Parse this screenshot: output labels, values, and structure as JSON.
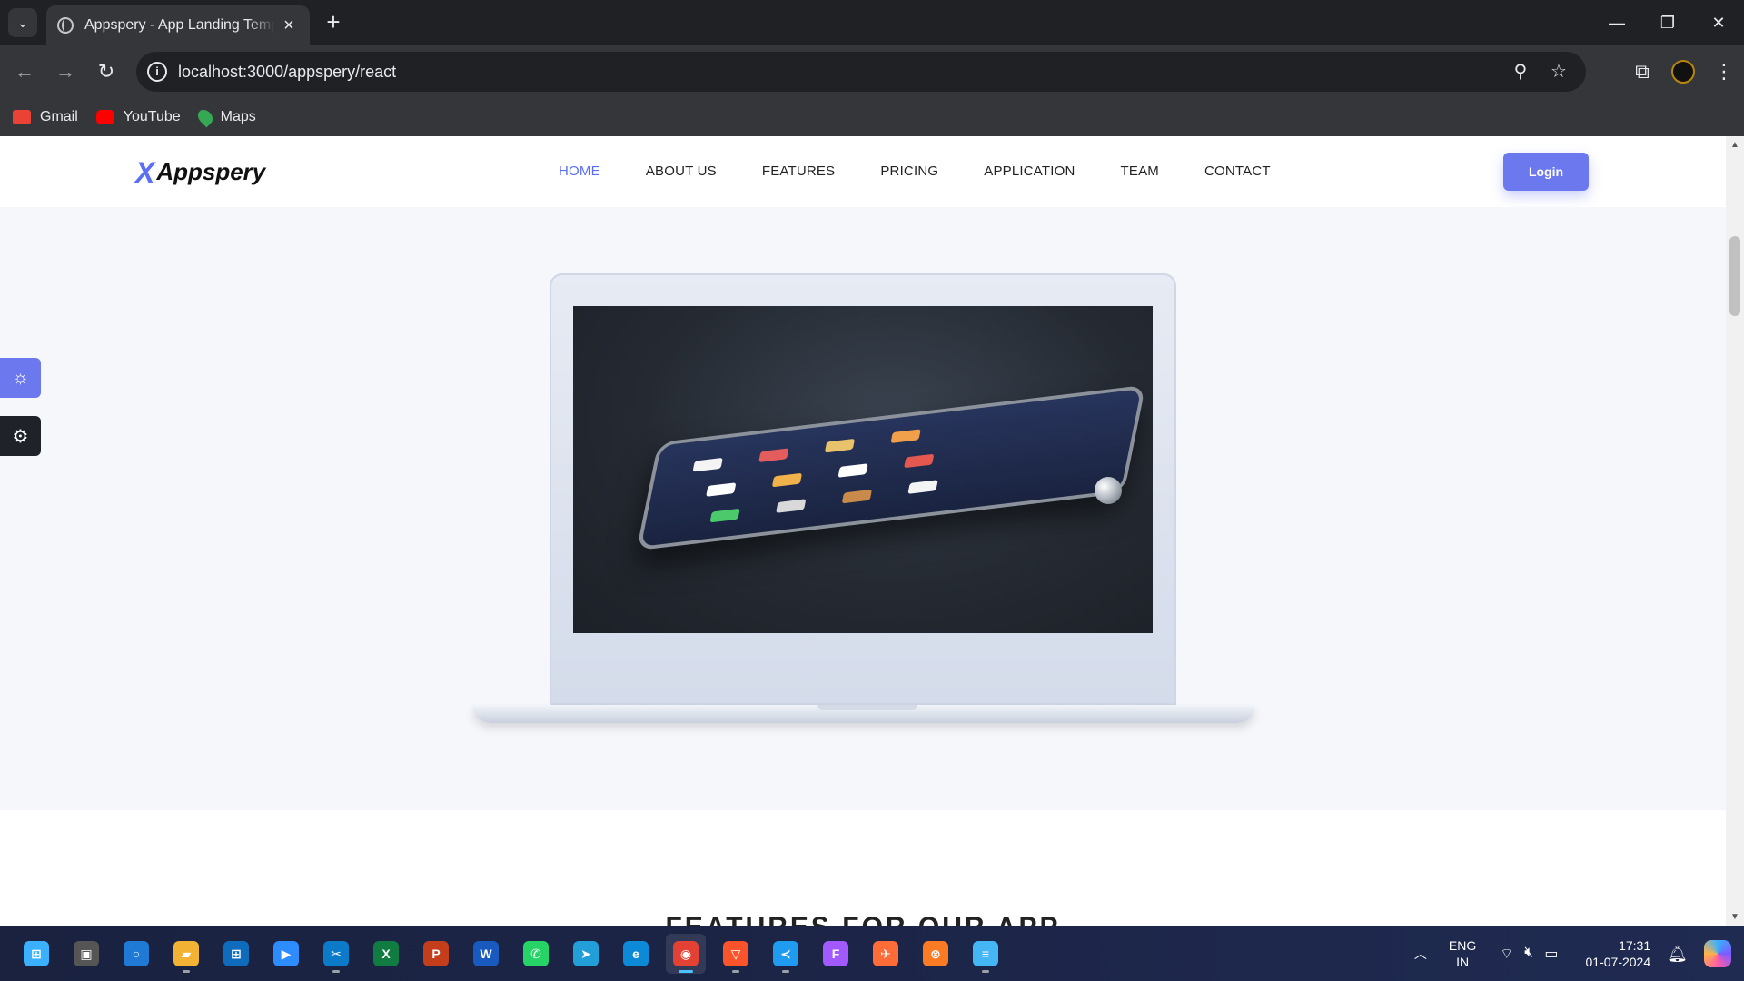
{
  "browser": {
    "tab_title": "Appspery - App Landing Template",
    "url": "localhost:3000/appspery/react",
    "bookmarks": [
      {
        "label": "Gmail",
        "color": "#ea4335"
      },
      {
        "label": "YouTube",
        "color": "#ff0000"
      },
      {
        "label": "Maps",
        "color": "#34a853"
      }
    ]
  },
  "site": {
    "logo_mark": "X",
    "logo_text": "Appspery",
    "nav": [
      {
        "label": "HOME",
        "active": true
      },
      {
        "label": "ABOUT US"
      },
      {
        "label": "FEATURES"
      },
      {
        "label": "PRICING"
      },
      {
        "label": "APPLICATION"
      },
      {
        "label": "TEAM"
      },
      {
        "label": "CONTACT"
      }
    ],
    "login_label": "Login",
    "accent_color": "#6b78ee",
    "next_section_title": "FEATURES FOR OUR APP"
  },
  "side_buttons": {
    "theme_icon": "sun-icon",
    "settings_icon": "gear-icon"
  },
  "taskbar": {
    "apps": [
      {
        "name": "start-icon",
        "color": "#3ab0ff",
        "glyph": "⊞"
      },
      {
        "name": "task-view-icon",
        "color": "#555",
        "glyph": "▣"
      },
      {
        "name": "cortana-icon",
        "color": "#1f7ad6",
        "glyph": "○"
      },
      {
        "name": "file-explorer-icon",
        "color": "#f2b233",
        "glyph": "▰"
      },
      {
        "name": "store-icon",
        "color": "#0f6cbd",
        "glyph": "⊞"
      },
      {
        "name": "zoom-icon",
        "color": "#2d8cff",
        "glyph": "▶"
      },
      {
        "name": "snipping-icon",
        "color": "#0b7ac8",
        "glyph": "✂"
      },
      {
        "name": "excel-icon",
        "color": "#107c41",
        "glyph": "X"
      },
      {
        "name": "powerpoint-icon",
        "color": "#c43e1c",
        "glyph": "P"
      },
      {
        "name": "word-icon",
        "color": "#185abd",
        "glyph": "W"
      },
      {
        "name": "whatsapp-icon",
        "color": "#25d366",
        "glyph": "✆"
      },
      {
        "name": "telegram-icon",
        "color": "#229ed9",
        "glyph": "➤"
      },
      {
        "name": "edge-icon",
        "color": "#0c8ad8",
        "glyph": "e"
      },
      {
        "name": "chrome-icon",
        "color": "#e34133",
        "glyph": "◉",
        "active": true
      },
      {
        "name": "brave-icon",
        "color": "#fb542b",
        "glyph": "▽"
      },
      {
        "name": "vscode-icon",
        "color": "#1f9cf0",
        "glyph": "≺"
      },
      {
        "name": "figma-icon",
        "color": "#a259ff",
        "glyph": "F"
      },
      {
        "name": "postman-icon",
        "color": "#ff6c37",
        "glyph": "✈"
      },
      {
        "name": "xampp-icon",
        "color": "#fb7a24",
        "glyph": "⊗"
      },
      {
        "name": "notepad-icon",
        "color": "#45b6f5",
        "glyph": "≡"
      }
    ],
    "lang_top": "ENG",
    "lang_bottom": "IN",
    "time": "17:31",
    "date": "01-07-2024"
  }
}
